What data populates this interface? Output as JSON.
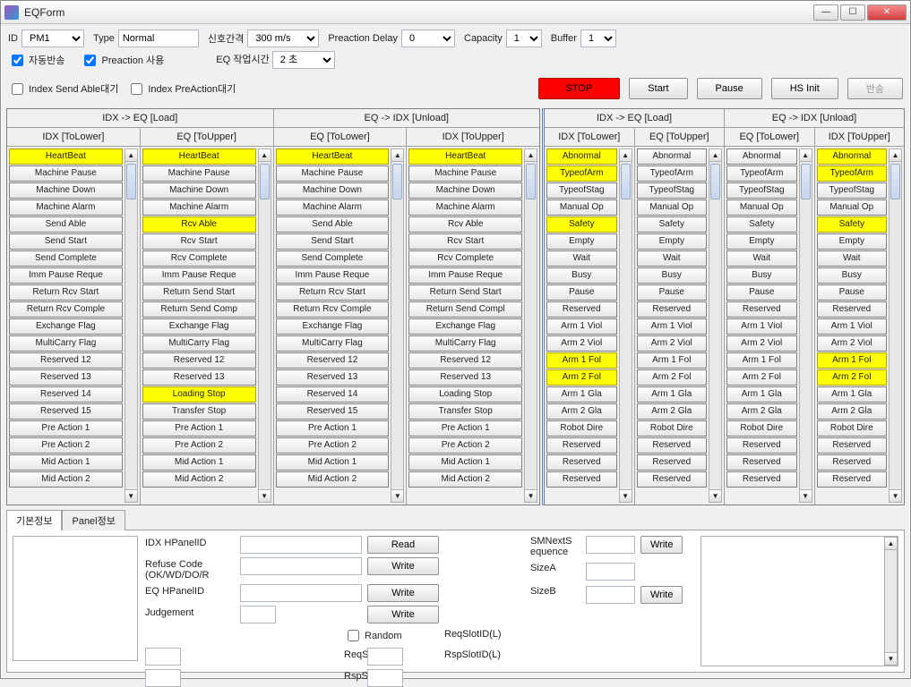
{
  "window": {
    "title": "EQForm"
  },
  "toolbar": {
    "id_label": "ID",
    "id_value": "PM1",
    "type_label": "Type",
    "type_value": "Normal",
    "signal_interval_label": "신호간격",
    "signal_interval_value": "300 m/s",
    "preaction_delay_label": "Preaction Delay",
    "preaction_delay_value": "0",
    "capacity_label": "Capacity",
    "capacity_value": "1",
    "buffer_label": "Buffer",
    "buffer_value": "1",
    "auto_return_label": "자동반송",
    "preaction_use_label": "Preaction 사용",
    "eq_worktime_label": "EQ 작업시간",
    "eq_worktime_value": "2 초",
    "index_send_able_label": "Index Send Able대기",
    "index_preaction_label": "Index PreAction대기",
    "stop": "STOP",
    "start": "Start",
    "pause": "Pause",
    "hs_init": "HS Init",
    "return": "반송"
  },
  "left_group": {
    "header_a": "IDX -> EQ [Load]",
    "header_b": "EQ -> IDX [Unload]",
    "cols": [
      {
        "head": "IDX [ToLower]",
        "items": [
          {
            "t": "HeartBeat",
            "hl": true
          },
          {
            "t": "Machine Pause"
          },
          {
            "t": "Machine Down"
          },
          {
            "t": "Machine Alarm"
          },
          {
            "t": "Send Able"
          },
          {
            "t": "Send Start"
          },
          {
            "t": "Send Complete"
          },
          {
            "t": "Imm Pause Reque"
          },
          {
            "t": "Return Rcv Start"
          },
          {
            "t": "Return Rcv Comple"
          },
          {
            "t": "Exchange Flag"
          },
          {
            "t": "MultiCarry Flag"
          },
          {
            "t": "Reserved 12"
          },
          {
            "t": "Reserved 13"
          },
          {
            "t": "Reserved 14"
          },
          {
            "t": "Reserved 15"
          },
          {
            "t": "Pre Action 1"
          },
          {
            "t": "Pre Action 2"
          },
          {
            "t": "Mid Action 1"
          },
          {
            "t": "Mid Action 2"
          }
        ]
      },
      {
        "head": "EQ [ToUpper]",
        "items": [
          {
            "t": "HeartBeat",
            "hl": true
          },
          {
            "t": "Machine Pause"
          },
          {
            "t": "Machine Down"
          },
          {
            "t": "Machine Alarm"
          },
          {
            "t": "Rcv Able",
            "hl": true
          },
          {
            "t": "Rcv Start"
          },
          {
            "t": "Rcv Complete"
          },
          {
            "t": "Imm Pause Reque"
          },
          {
            "t": "Return Send Start"
          },
          {
            "t": "Return Send Comp"
          },
          {
            "t": "Exchange Flag"
          },
          {
            "t": "MultiCarry Flag"
          },
          {
            "t": "Reserved 12"
          },
          {
            "t": "Reserved 13"
          },
          {
            "t": "Loading Stop",
            "hl": true
          },
          {
            "t": "Transfer Stop"
          },
          {
            "t": "Pre Action 1"
          },
          {
            "t": "Pre Action 2"
          },
          {
            "t": "Mid Action 1"
          },
          {
            "t": "Mid Action 2"
          }
        ]
      },
      {
        "head": "EQ [ToLower]",
        "items": [
          {
            "t": "HeartBeat",
            "hl": true
          },
          {
            "t": "Machine Pause"
          },
          {
            "t": "Machine Down"
          },
          {
            "t": "Machine Alarm"
          },
          {
            "t": "Send Able"
          },
          {
            "t": "Send Start"
          },
          {
            "t": "Send Complete"
          },
          {
            "t": "Imm Pause Reque"
          },
          {
            "t": "Return Rcv Start"
          },
          {
            "t": "Return Rcv Comple"
          },
          {
            "t": "Exchange Flag"
          },
          {
            "t": "MultiCarry Flag"
          },
          {
            "t": "Reserved 12"
          },
          {
            "t": "Reserved 13"
          },
          {
            "t": "Reserved 14"
          },
          {
            "t": "Reserved 15"
          },
          {
            "t": "Pre Action 1"
          },
          {
            "t": "Pre Action 2"
          },
          {
            "t": "Mid Action 1"
          },
          {
            "t": "Mid Action 2"
          }
        ]
      },
      {
        "head": "IDX [ToUpper]",
        "items": [
          {
            "t": "HeartBeat",
            "hl": true
          },
          {
            "t": "Machine Pause"
          },
          {
            "t": "Machine Down"
          },
          {
            "t": "Machine Alarm"
          },
          {
            "t": "Rcv Able"
          },
          {
            "t": "Rcv Start"
          },
          {
            "t": "Rcv Complete"
          },
          {
            "t": "Imm Pause Reque"
          },
          {
            "t": "Return Send Start"
          },
          {
            "t": "Return Send Compl"
          },
          {
            "t": "Exchange Flag"
          },
          {
            "t": "MultiCarry Flag"
          },
          {
            "t": "Reserved 12"
          },
          {
            "t": "Reserved 13"
          },
          {
            "t": "Loading Stop"
          },
          {
            "t": "Transfer Stop"
          },
          {
            "t": "Pre Action 1"
          },
          {
            "t": "Pre Action 2"
          },
          {
            "t": "Mid Action 1"
          },
          {
            "t": "Mid Action 2"
          }
        ]
      }
    ]
  },
  "right_group": {
    "header_a": "IDX -> EQ [Load]",
    "header_b": "EQ -> IDX [Unload]",
    "cols": [
      {
        "head": "IDX [ToLower]",
        "items": [
          {
            "t": "Abnormal",
            "hl": true
          },
          {
            "t": "TypeofArm",
            "hl": true
          },
          {
            "t": "TypeofStag"
          },
          {
            "t": "Manual Op"
          },
          {
            "t": "Safety",
            "hl": true
          },
          {
            "t": "Empty"
          },
          {
            "t": "Wait"
          },
          {
            "t": "Busy"
          },
          {
            "t": "Pause"
          },
          {
            "t": "Reserved"
          },
          {
            "t": "Arm 1 Viol"
          },
          {
            "t": "Arm 2 Viol"
          },
          {
            "t": "Arm 1 Fol",
            "hl": true
          },
          {
            "t": "Arm 2 Fol",
            "hl": true
          },
          {
            "t": "Arm 1 Gla"
          },
          {
            "t": "Arm 2 Gla"
          },
          {
            "t": "Robot Dire"
          },
          {
            "t": "Reserved"
          },
          {
            "t": "Reserved"
          },
          {
            "t": "Reserved"
          }
        ]
      },
      {
        "head": "EQ [ToUpper]",
        "items": [
          {
            "t": "Abnormal"
          },
          {
            "t": "TypeofArm"
          },
          {
            "t": "TypeofStag"
          },
          {
            "t": "Manual Op"
          },
          {
            "t": "Safety"
          },
          {
            "t": "Empty"
          },
          {
            "t": "Wait"
          },
          {
            "t": "Busy"
          },
          {
            "t": "Pause"
          },
          {
            "t": "Reserved"
          },
          {
            "t": "Arm 1 Viol"
          },
          {
            "t": "Arm 2 Viol"
          },
          {
            "t": "Arm 1 Fol"
          },
          {
            "t": "Arm 2 Fol"
          },
          {
            "t": "Arm 1 Gla"
          },
          {
            "t": "Arm 2 Gla"
          },
          {
            "t": "Robot Dire"
          },
          {
            "t": "Reserved"
          },
          {
            "t": "Reserved"
          },
          {
            "t": "Reserved"
          }
        ]
      },
      {
        "head": "EQ [ToLower]",
        "items": [
          {
            "t": "Abnormal"
          },
          {
            "t": "TypeofArm"
          },
          {
            "t": "TypeofStag"
          },
          {
            "t": "Manual Op"
          },
          {
            "t": "Safety"
          },
          {
            "t": "Empty"
          },
          {
            "t": "Wait"
          },
          {
            "t": "Busy"
          },
          {
            "t": "Pause"
          },
          {
            "t": "Reserved"
          },
          {
            "t": "Arm 1 Viol"
          },
          {
            "t": "Arm 2 Viol"
          },
          {
            "t": "Arm 1 Fol"
          },
          {
            "t": "Arm 2 Fol"
          },
          {
            "t": "Arm 1 Gla"
          },
          {
            "t": "Arm 2 Gla"
          },
          {
            "t": "Robot Dire"
          },
          {
            "t": "Reserved"
          },
          {
            "t": "Reserved"
          },
          {
            "t": "Reserved"
          }
        ]
      },
      {
        "head": "IDX [ToUpper]",
        "items": [
          {
            "t": "Abnormal",
            "hl": true
          },
          {
            "t": "TypeofArm",
            "hl": true
          },
          {
            "t": "TypeofStag"
          },
          {
            "t": "Manual Op"
          },
          {
            "t": "Safety",
            "hl": true
          },
          {
            "t": "Empty"
          },
          {
            "t": "Wait"
          },
          {
            "t": "Busy"
          },
          {
            "t": "Pause"
          },
          {
            "t": "Reserved"
          },
          {
            "t": "Arm 1 Viol"
          },
          {
            "t": "Arm 2 Viol"
          },
          {
            "t": "Arm 1 Fol",
            "hl": true
          },
          {
            "t": "Arm 2 Fol",
            "hl": true
          },
          {
            "t": "Arm 1 Gla"
          },
          {
            "t": "Arm 2 Gla"
          },
          {
            "t": "Robot Dire"
          },
          {
            "t": "Reserved"
          },
          {
            "t": "Reserved"
          },
          {
            "t": "Reserved"
          }
        ]
      }
    ]
  },
  "tabs": {
    "tab1": "기본정보",
    "tab2": "Panel정보"
  },
  "form": {
    "idx_hpanelid": "IDX HPanelID",
    "refuse_code": "Refuse Code (OK/WD/DO/R",
    "eq_hpanelid": "EQ HPanelID",
    "judgement": "Judgement",
    "random": "Random",
    "reqslot_l": "ReqSlotID(L)",
    "reqslot_u": "ReqSlotID(U)",
    "rspslot_l": "RspSlotID(L)",
    "rspslot_u": "RspSlotID(U)",
    "read": "Read",
    "write": "Write",
    "smnext": "SMNextS equence",
    "sizea": "SizeA",
    "sizeb": "SizeB"
  }
}
